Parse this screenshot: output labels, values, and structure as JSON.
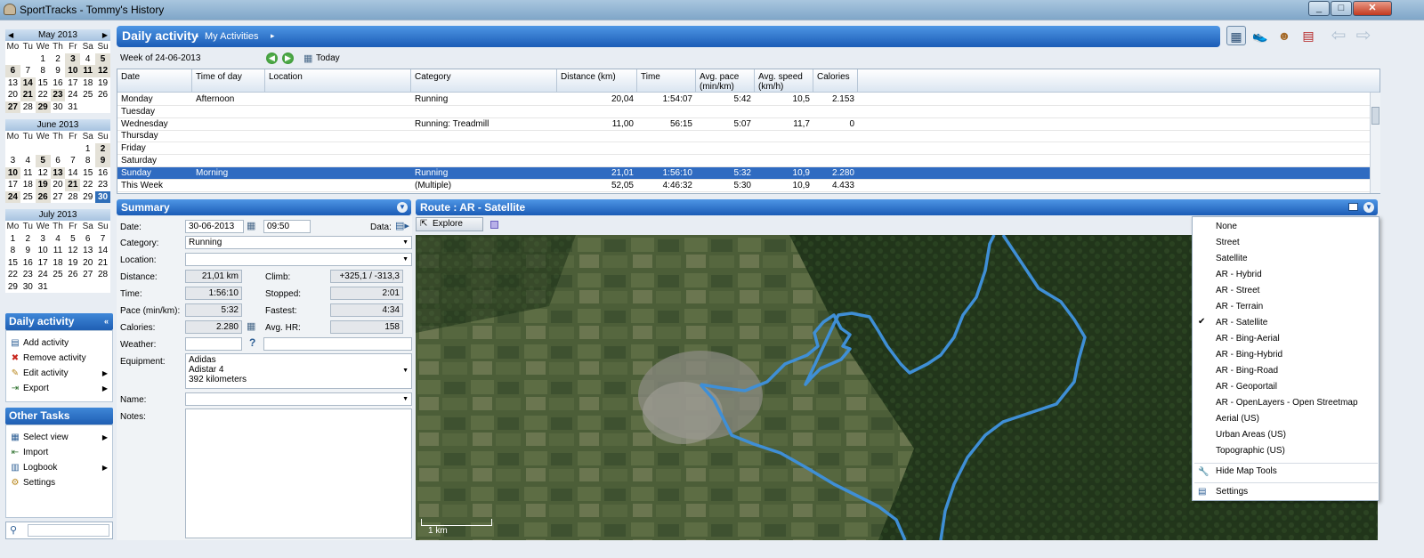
{
  "app": {
    "title": "SportTracks - Tommy's History"
  },
  "window_buttons": [
    "_",
    "□",
    "✕"
  ],
  "calendars": [
    {
      "month": "May 2013",
      "days_header": [
        "Mo",
        "Tu",
        "We",
        "Th",
        "Fr",
        "Sa",
        "Su"
      ],
      "cells": [
        "",
        "",
        "1",
        "2",
        "3",
        "4",
        "5",
        "6",
        "7",
        "8",
        "9",
        "10",
        "11",
        "12",
        "13",
        "14",
        "15",
        "16",
        "17",
        "18",
        "19",
        "20",
        "21",
        "22",
        "23",
        "24",
        "25",
        "26",
        "27",
        "28",
        "29",
        "30",
        "31",
        "",
        ""
      ]
    },
    {
      "month": "June 2013",
      "days_header": [
        "Mo",
        "Tu",
        "We",
        "Th",
        "Fr",
        "Sa",
        "Su"
      ],
      "cells": [
        "",
        "",
        "",
        "",
        "",
        "1",
        "2",
        "3",
        "4",
        "5",
        "6",
        "7",
        "8",
        "9",
        "10",
        "11",
        "12",
        "13",
        "14",
        "15",
        "16",
        "17",
        "18",
        "19",
        "20",
        "21",
        "22",
        "23",
        "24",
        "25",
        "26",
        "27",
        "28",
        "29",
        "30"
      ]
    },
    {
      "month": "July 2013",
      "days_header": [
        "Mo",
        "Tu",
        "We",
        "Th",
        "Fr",
        "Sa",
        "Su"
      ],
      "cells": [
        "1",
        "2",
        "3",
        "4",
        "5",
        "6",
        "7",
        "8",
        "9",
        "10",
        "11",
        "12",
        "13",
        "14",
        "15",
        "16",
        "17",
        "18",
        "19",
        "20",
        "21",
        "22",
        "23",
        "24",
        "25",
        "26",
        "27",
        "28",
        "29",
        "30",
        "31",
        "",
        "",
        "",
        ""
      ]
    }
  ],
  "bold_days": {
    "0": [
      "3",
      "5",
      "6",
      "10",
      "11",
      "12",
      "14",
      "21",
      "23",
      "27",
      "29"
    ],
    "1": [
      "2",
      "5",
      "9",
      "10",
      "13",
      "19",
      "21",
      "24",
      "26"
    ],
    "2": []
  },
  "selected_day": {
    "cal": "1",
    "day": "30"
  },
  "daily_panel": {
    "title": "Daily activity",
    "items": [
      {
        "label": "Add activity",
        "icon": "add-activity-icon",
        "sub": ""
      },
      {
        "label": "Remove activity",
        "icon": "remove-icon",
        "sub": ""
      },
      {
        "label": "Edit activity",
        "icon": "pencil-icon",
        "sub": "▶"
      },
      {
        "label": "Export",
        "icon": "export-icon",
        "sub": "▶"
      }
    ]
  },
  "other_panel": {
    "title": "Other Tasks",
    "items": [
      {
        "label": "Select view",
        "icon": "select-view-icon",
        "sub": "▶"
      },
      {
        "label": "Import",
        "icon": "import-icon",
        "sub": ""
      },
      {
        "label": "Logbook",
        "icon": "logbook-icon",
        "sub": "▶"
      },
      {
        "label": "Settings",
        "icon": "settings-icon",
        "sub": ""
      }
    ]
  },
  "header": {
    "title": "Daily activity",
    "crumb": "My Activities"
  },
  "week": {
    "label": "Week of 24-06-2013",
    "today": "Today"
  },
  "grid": {
    "columns": [
      "Date",
      "Time of day",
      "Location",
      "Category",
      "Distance (km)",
      "Time",
      "Avg. pace (min/km)",
      "Avg. speed (km/h)",
      "Calories"
    ],
    "rows": [
      [
        "Monday",
        "Afternoon",
        "",
        "Running",
        "20,04",
        "1:54:07",
        "5:42",
        "10,5",
        "2.153"
      ],
      [
        "Tuesday",
        "",
        "",
        "",
        "",
        "",
        "",
        "",
        ""
      ],
      [
        "Wednesday",
        "",
        "",
        "Running: Treadmill",
        "11,00",
        "56:15",
        "5:07",
        "11,7",
        "0"
      ],
      [
        "Thursday",
        "",
        "",
        "",
        "",
        "",
        "",
        "",
        ""
      ],
      [
        "Friday",
        "",
        "",
        "",
        "",
        "",
        "",
        "",
        ""
      ],
      [
        "Saturday",
        "",
        "",
        "",
        "",
        "",
        "",
        "",
        ""
      ],
      [
        "Sunday",
        "Morning",
        "",
        "Running",
        "21,01",
        "1:56:10",
        "5:32",
        "10,9",
        "2.280"
      ],
      [
        "This Week",
        "",
        "",
        "(Multiple)",
        "52,05",
        "4:46:32",
        "5:30",
        "10,9",
        "4.433"
      ]
    ],
    "selected_row": 6
  },
  "summary": {
    "title": "Summary",
    "date_label": "Date:",
    "date": "30-06-2013",
    "time": "09:50",
    "data_label": "Data:",
    "category_label": "Category:",
    "category": "Running",
    "location_label": "Location:",
    "location": "",
    "distance_label": "Distance:",
    "distance": "21,01 km",
    "climb_label": "Climb:",
    "climb": "+325,1 / -313,3",
    "time_label": "Time:",
    "time_val": "1:56:10",
    "stopped_label": "Stopped:",
    "stopped": "2:01",
    "pace_label": "Pace (min/km):",
    "pace": "5:32",
    "fastest_label": "Fastest:",
    "fastest": "4:34",
    "calories_label": "Calories:",
    "calories": "2.280",
    "avghr_label": "Avg. HR:",
    "avghr": "158",
    "weather_label": "Weather:",
    "weather_q": "?",
    "equipment_label": "Equipment:",
    "equipment": [
      "Adidas",
      "Adistar 4",
      "392 kilometers"
    ],
    "name_label": "Name:",
    "notes_label": "Notes:"
  },
  "route": {
    "title": "Route : AR - Satellite",
    "explore": "Explore",
    "scale": "1 km"
  },
  "map_menu": {
    "items": [
      "None",
      "Street",
      "Satellite",
      "AR - Hybrid",
      "AR - Street",
      "AR - Terrain",
      "AR - Satellite",
      "AR - Bing-Aerial",
      "AR - Bing-Hybrid",
      "AR - Bing-Road",
      "AR - Geoportail",
      "AR - OpenLayers - Open Streetmap",
      "Aerial (US)",
      "Urban Areas (US)",
      "Topographic (US)"
    ],
    "checked": "AR - Satellite",
    "hide_tools": "Hide Map Tools",
    "settings": "Settings"
  },
  "colors": {
    "accent": "#1f5fb3",
    "selection": "#2f6bc1",
    "route": "#3f8fd6"
  }
}
